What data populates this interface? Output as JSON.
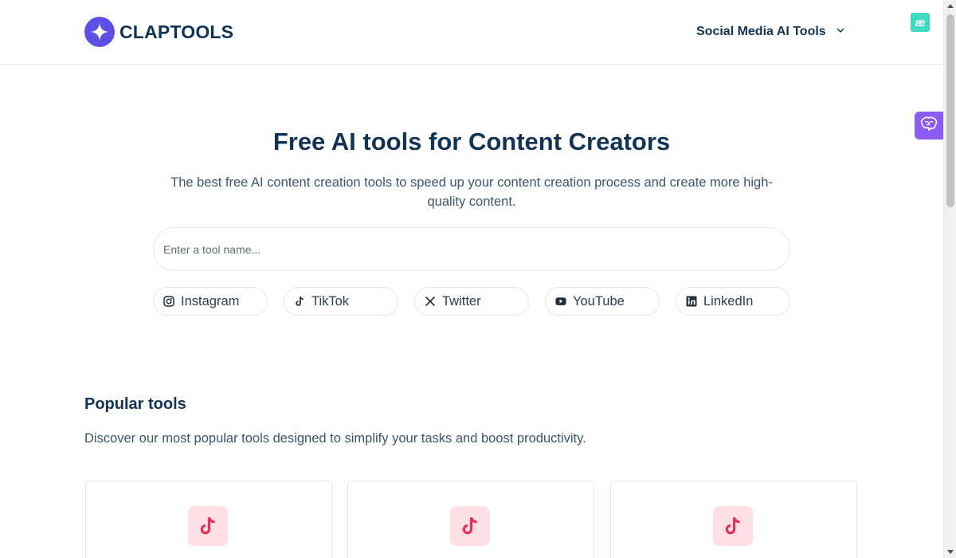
{
  "header": {
    "brand": "CLAPTOOLS",
    "nav_label": "Social Media AI Tools",
    "ext_badge": "æ"
  },
  "hero": {
    "title": "Free AI tools for Content Creators",
    "subtitle": "The best free AI content creation tools to speed up your content creation process and create more high-quality content.",
    "search_placeholder": "Enter a tool name..."
  },
  "platforms": [
    {
      "label": "Instagram",
      "icon": "instagram-icon"
    },
    {
      "label": "TikTok",
      "icon": "tiktok-icon"
    },
    {
      "label": "Twitter",
      "icon": "x-twitter-icon"
    },
    {
      "label": "YouTube",
      "icon": "youtube-icon"
    },
    {
      "label": "LinkedIn",
      "icon": "linkedin-icon"
    }
  ],
  "popular": {
    "title": "Popular tools",
    "subtitle": "Discover our most popular tools designed to simplify your tasks and boost productivity.",
    "cards": [
      {
        "icon": "tiktok-icon"
      },
      {
        "icon": "tiktok-icon"
      },
      {
        "icon": "tiktok-icon"
      }
    ]
  },
  "colors": {
    "brand": "#5b4fe6",
    "text_dark": "#123454",
    "widget": "#8b5cf6",
    "tiktok_bg": "#fde0e6",
    "tiktok_fg": "#e8305a",
    "ext_badge": "#3ddbc1"
  }
}
